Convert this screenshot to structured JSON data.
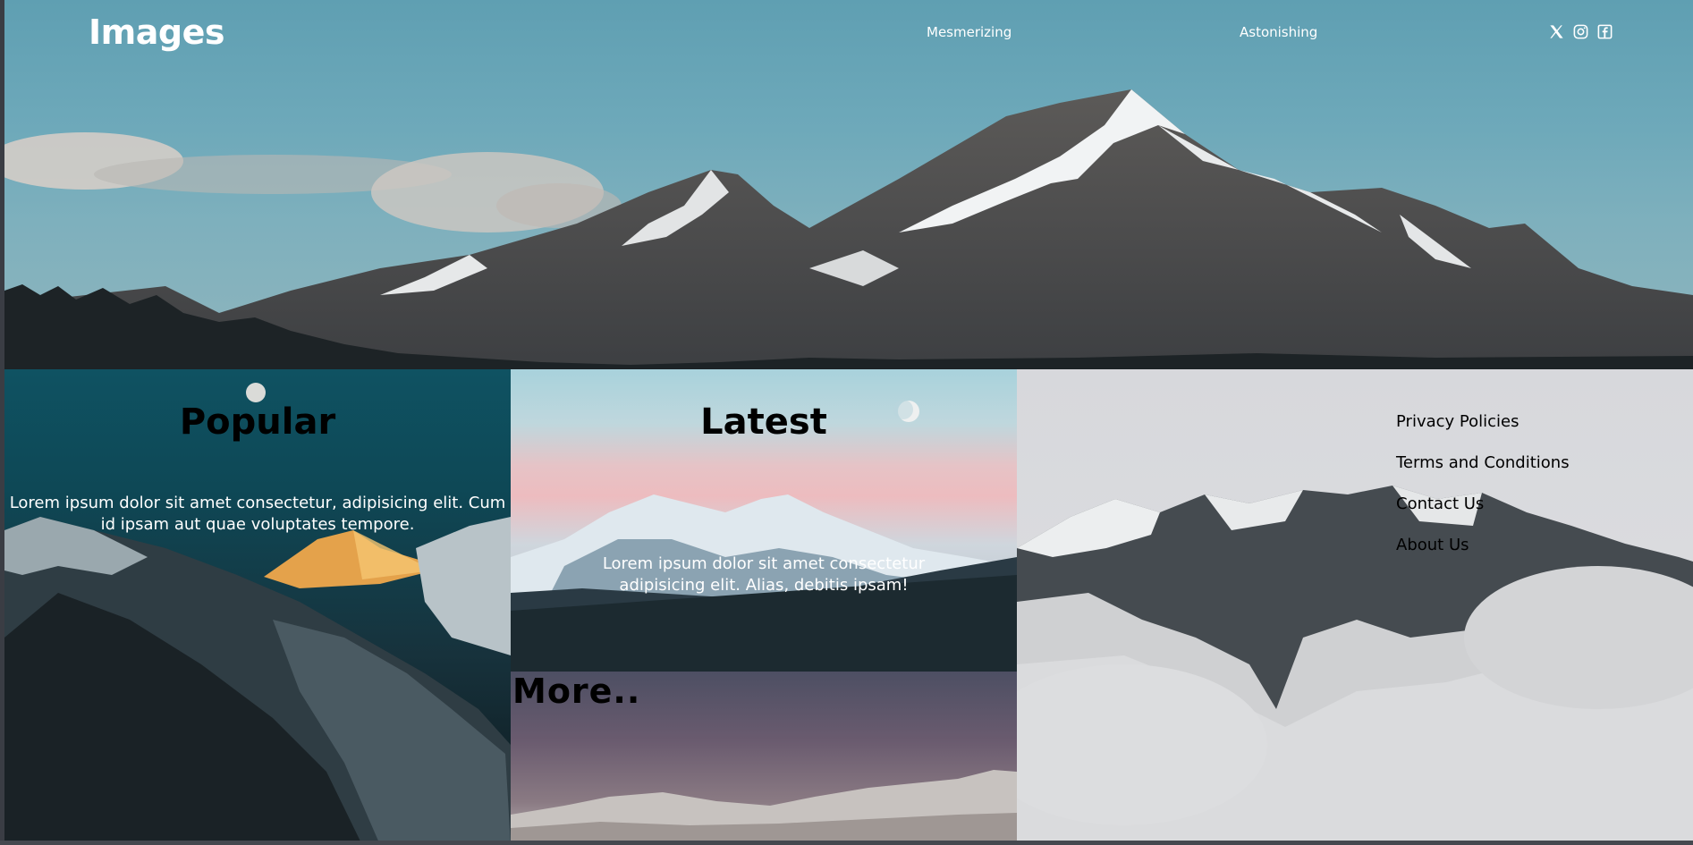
{
  "header": {
    "logo": "Images",
    "nav": [
      {
        "label": "Mesmerizing"
      },
      {
        "label": "Astonishing"
      }
    ],
    "socials": [
      {
        "icon": "x-twitter-icon"
      },
      {
        "icon": "instagram-icon"
      },
      {
        "icon": "facebook-icon"
      }
    ]
  },
  "sections": {
    "popular": {
      "title": "Popular",
      "text": "Lorem ipsum dolor sit amet consectetur, adipisicing elit. Cum id ipsam aut quae voluptates tempore."
    },
    "latest": {
      "title": "Latest",
      "text": "Lorem ipsum dolor sit amet consectetur adipisicing elit. Alias, debitis ipsam!"
    },
    "more": {
      "title": "More.."
    }
  },
  "footer": {
    "links": [
      {
        "label": "Privacy Policies"
      },
      {
        "label": "Terms and Conditions"
      },
      {
        "label": "Contact Us"
      },
      {
        "label": "About Us"
      }
    ]
  },
  "colors": {
    "sky": "#6ea9ba",
    "popular_bg": "#0f5262",
    "text_light": "#ffffff",
    "text_dark": "#000000"
  }
}
